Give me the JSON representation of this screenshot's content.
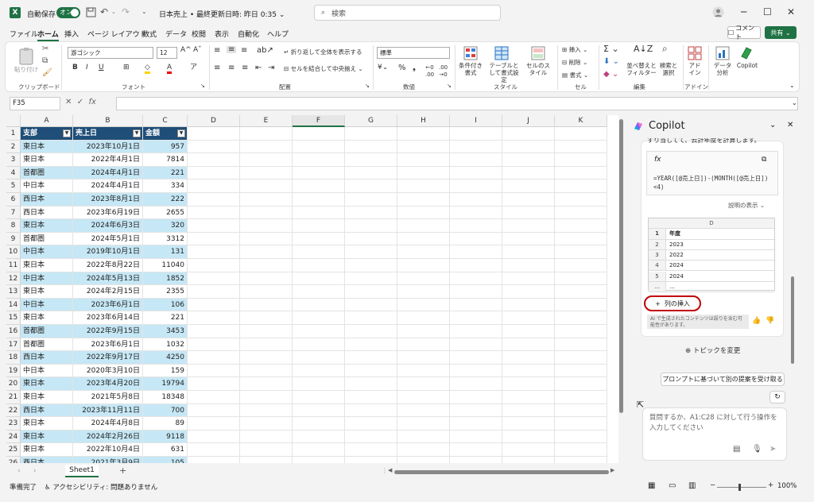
{
  "titlebar": {
    "app_icon": "X",
    "autosave_label": "自動保存",
    "autosave_state": "オン",
    "doc_title": "日本売上 • 最終更新日時: 昨日 0:35 ⌄",
    "search_placeholder": "検索"
  },
  "menu": {
    "items": [
      "ファイル",
      "ホーム",
      "挿入",
      "ページ レイアウト",
      "数式",
      "データ",
      "校閲",
      "表示",
      "自動化",
      "ヘルプ"
    ],
    "comment_label": "コメント",
    "share_label": "共有"
  },
  "ribbon": {
    "clipboard": {
      "paste": "貼り付け",
      "group": "クリップボード"
    },
    "font": {
      "name": "游ゴシック",
      "size": "12",
      "group": "フォント"
    },
    "alignment": {
      "wrap": "折り返して全体を表示する",
      "merge": "セルを結合して中央揃え",
      "group": "配置"
    },
    "number": {
      "format": "標準",
      "group": "数値"
    },
    "styles": {
      "conditional": "条件付き書式",
      "table": "テーブルとして書式設定",
      "cell": "セルのスタイル",
      "group": "スタイル"
    },
    "cells": {
      "insert": "挿入",
      "delete": "削除",
      "format": "書式",
      "group": "セル"
    },
    "editing": {
      "sort": "並べ替えとフィルター",
      "find": "検索と選択",
      "group": "編集"
    },
    "addins": {
      "label": "アドイン",
      "group": "アドイン"
    },
    "analyze": {
      "label": "データ分析"
    },
    "copilot": {
      "label": "Copilot"
    }
  },
  "formula_bar": {
    "name_box": "F35",
    "content": ""
  },
  "grid": {
    "columns": [
      "A",
      "B",
      "C",
      "D",
      "E",
      "F",
      "G",
      "H",
      "I",
      "J",
      "K"
    ],
    "header": [
      "支部",
      "売上日",
      "金額"
    ],
    "rows": [
      [
        "東日本",
        "2023年10月1日",
        "957"
      ],
      [
        "東日本",
        "2022年4月1日",
        "7814"
      ],
      [
        "首都圏",
        "2024年4月1日",
        "221"
      ],
      [
        "中日本",
        "2024年4月1日",
        "334"
      ],
      [
        "西日本",
        "2023年8月1日",
        "222"
      ],
      [
        "西日本",
        "2023年6月19日",
        "2655"
      ],
      [
        "東日本",
        "2024年6月3日",
        "320"
      ],
      [
        "首都圏",
        "2024年5月1日",
        "3312"
      ],
      [
        "中日本",
        "2019年10月1日",
        "131"
      ],
      [
        "東日本",
        "2022年8月22日",
        "11040"
      ],
      [
        "中日本",
        "2024年5月13日",
        "1852"
      ],
      [
        "東日本",
        "2024年2月15日",
        "2355"
      ],
      [
        "中日本",
        "2023年6月1日",
        "106"
      ],
      [
        "東日本",
        "2023年6月14日",
        "221"
      ],
      [
        "首都圏",
        "2022年9月15日",
        "3453"
      ],
      [
        "首都圏",
        "2023年6月1日",
        "1032"
      ],
      [
        "西日本",
        "2022年9月17日",
        "4250"
      ],
      [
        "中日本",
        "2020年3月10日",
        "159"
      ],
      [
        "東日本",
        "2023年4月20日",
        "19794"
      ],
      [
        "東日本",
        "2021年5月8日",
        "18348"
      ],
      [
        "西日本",
        "2023年11月11日",
        "700"
      ],
      [
        "東日本",
        "2024年4月8日",
        "89"
      ],
      [
        "東日本",
        "2024年2月26日",
        "9118"
      ],
      [
        "東日本",
        "2022年10月4日",
        "631"
      ],
      [
        "西日本",
        "2021年3月9日",
        "105"
      ]
    ]
  },
  "sheet_tabs": [
    "Sheet1"
  ],
  "status": {
    "ready": "準備完了",
    "accessibility": "アクセシビリティ: 問題ありません",
    "zoom": "100%"
  },
  "copilot": {
    "title": "Copilot",
    "cut_text": "すり当してて、云計年度を計算します。",
    "fx": "fx",
    "formula": "=YEAR([@売上日])-(MONTH([@売上日])<4)",
    "explain": "説明の表示 ⌄",
    "table_col": "D",
    "table_rows": [
      [
        "1",
        "年度"
      ],
      [
        "2",
        "2023"
      ],
      [
        "3",
        "2022"
      ],
      [
        "4",
        "2024"
      ],
      [
        "5",
        "2024"
      ],
      [
        "...",
        "..."
      ]
    ],
    "insert_col": "列の挿入",
    "disclaimer": "AI で生成されたコンテンツは誤りを含む可能性があります。",
    "topic": "トピックを変更",
    "suggest": "プロンプトに基づいて別の提案を受け取る",
    "input_placeholder": "質問するか、A1:C28 に対して行う操作を入力してください"
  }
}
